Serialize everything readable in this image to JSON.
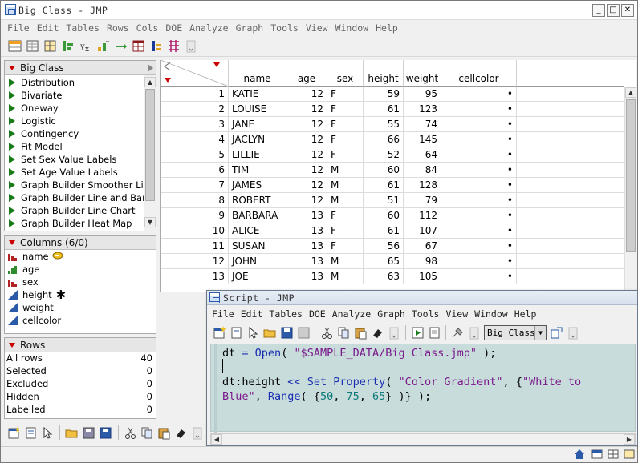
{
  "window": {
    "title": "Big Class - JMP",
    "minimize": "_",
    "maximize": "□",
    "close": "✕"
  },
  "menu": [
    "File",
    "Edit",
    "Tables",
    "Rows",
    "Cols",
    "DOE",
    "Analyze",
    "Graph",
    "Tools",
    "View",
    "Window",
    "Help"
  ],
  "table_panel": {
    "title": "Big Class",
    "scripts": [
      "Distribution",
      "Bivariate",
      "Oneway",
      "Logistic",
      "Contingency",
      "Fit Model",
      "Set Sex Value Labels",
      "Set Age Value Labels",
      "Graph Builder Smoother Line",
      "Graph Builder Line and Bar Chart",
      "Graph Builder Line Chart",
      "Graph Builder Heat Map"
    ]
  },
  "columns_panel": {
    "title": "Columns (6/0)",
    "columns": [
      {
        "name": "name",
        "type": "nominal",
        "marker": "key"
      },
      {
        "name": "age",
        "type": "ordinal",
        "marker": ""
      },
      {
        "name": "sex",
        "type": "nominal",
        "marker": ""
      },
      {
        "name": "height",
        "type": "continuous",
        "marker": "✱"
      },
      {
        "name": "weight",
        "type": "continuous",
        "marker": ""
      },
      {
        "name": "cellcolor",
        "type": "continuous",
        "marker": ""
      }
    ]
  },
  "rows_panel": {
    "title": "Rows",
    "stats": [
      {
        "label": "All rows",
        "value": "40"
      },
      {
        "label": "Selected",
        "value": "0"
      },
      {
        "label": "Excluded",
        "value": "0"
      },
      {
        "label": "Hidden",
        "value": "0"
      },
      {
        "label": "Labelled",
        "value": "0"
      }
    ]
  },
  "grid": {
    "headers": [
      "name",
      "age",
      "sex",
      "height",
      "weight",
      "cellcolor"
    ],
    "rows": [
      [
        "1",
        "KATIE",
        "12",
        "F",
        "59",
        "95",
        "•"
      ],
      [
        "2",
        "LOUISE",
        "12",
        "F",
        "61",
        "123",
        "•"
      ],
      [
        "3",
        "JANE",
        "12",
        "F",
        "55",
        "74",
        "•"
      ],
      [
        "4",
        "JACLYN",
        "12",
        "F",
        "66",
        "145",
        "•"
      ],
      [
        "5",
        "LILLIE",
        "12",
        "F",
        "52",
        "64",
        "•"
      ],
      [
        "6",
        "TIM",
        "12",
        "M",
        "60",
        "84",
        "•"
      ],
      [
        "7",
        "JAMES",
        "12",
        "M",
        "61",
        "128",
        "•"
      ],
      [
        "8",
        "ROBERT",
        "12",
        "M",
        "51",
        "79",
        "•"
      ],
      [
        "9",
        "BARBARA",
        "13",
        "F",
        "60",
        "112",
        "•"
      ],
      [
        "10",
        "ALICE",
        "13",
        "F",
        "61",
        "107",
        "•"
      ],
      [
        "11",
        "SUSAN",
        "13",
        "F",
        "56",
        "67",
        "•"
      ],
      [
        "12",
        "JOHN",
        "13",
        "M",
        "65",
        "98",
        "•"
      ],
      [
        "13",
        "JOE",
        "13",
        "M",
        "63",
        "105",
        "•"
      ]
    ]
  },
  "script_window": {
    "title": "Script - JMP",
    "menu": [
      "File",
      "Edit",
      "Tables",
      "DOE",
      "Analyze",
      "Graph",
      "Tools",
      "View",
      "Window",
      "Help"
    ],
    "table_select": "Big Class",
    "code_lines": [
      [
        [
          "kw-black",
          "dt "
        ],
        [
          "kw-blue",
          "="
        ],
        [
          "kw-black",
          " "
        ],
        [
          "kw-blue",
          "Open"
        ],
        [
          "kw-black",
          "( "
        ],
        [
          "kw-purple",
          "\"$SAMPLE_DATA/Big Class.jmp\""
        ],
        [
          "kw-black",
          " );"
        ]
      ],
      [],
      [
        [
          "kw-black",
          "dt:height "
        ],
        [
          "kw-blue",
          "<<"
        ],
        [
          "kw-black",
          " "
        ],
        [
          "kw-blue",
          "Set Property"
        ],
        [
          "kw-black",
          "( "
        ],
        [
          "kw-purple",
          "\"Color Gradient\""
        ],
        [
          "kw-black",
          ", {"
        ],
        [
          "kw-purple",
          "\"White to"
        ]
      ],
      [
        [
          "kw-purple",
          "Blue\""
        ],
        [
          "kw-black",
          ", "
        ],
        [
          "kw-blue",
          "Range"
        ],
        [
          "kw-black",
          "( {"
        ],
        [
          "kw-teal",
          "50"
        ],
        [
          "kw-black",
          ", "
        ],
        [
          "kw-teal",
          "75"
        ],
        [
          "kw-black",
          ", "
        ],
        [
          "kw-teal",
          "65"
        ],
        [
          "kw-black",
          "} )} );"
        ]
      ]
    ]
  },
  "colors": {
    "red_triangle": "#cc0000",
    "script_green": "#1a7a1a",
    "editor_bg": "#c8dcdc",
    "nominal": "#b22222",
    "continuous": "#2a5aa8",
    "ordinal": "#2e8b2e"
  }
}
